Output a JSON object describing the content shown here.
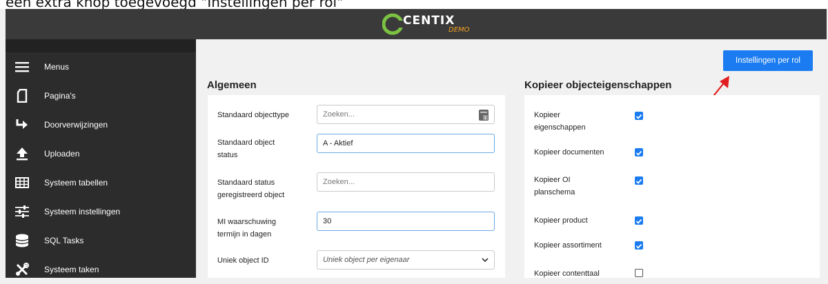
{
  "caption": "een extra knop toegevoegd \"Instellingen per rol\"",
  "app": {
    "logo_text": "CENTIX",
    "logo_sub": "DEMO"
  },
  "sidebar": {
    "items": [
      {
        "label": "Menus",
        "icon": "hamburger-icon"
      },
      {
        "label": "Pagina's",
        "icon": "page-icon"
      },
      {
        "label": "Doorverwijzingen",
        "icon": "redirect-arrow-icon"
      },
      {
        "label": "Uploaden",
        "icon": "upload-icon"
      },
      {
        "label": "Systeem tabellen",
        "icon": "table-icon"
      },
      {
        "label": "Systeem instellingen",
        "icon": "sliders-icon"
      },
      {
        "label": "SQL Tasks",
        "icon": "database-icon"
      },
      {
        "label": "Systeem taken",
        "icon": "tools-icon"
      }
    ]
  },
  "toolbar": {
    "roles_button": "Instellingen per rol"
  },
  "algemeen": {
    "title": "Algemeen",
    "fields": [
      {
        "label": "Standaard objecttype",
        "value": "",
        "placeholder": "Zoeken..."
      },
      {
        "label": "Standaard object status",
        "value": "A - Aktief",
        "placeholder": ""
      },
      {
        "label": "Standaard status geregistreerd object",
        "value": "",
        "placeholder": "Zoeken..."
      },
      {
        "label": "MI waarschuwing termijn in dagen",
        "value": "30",
        "placeholder": ""
      },
      {
        "label": "Uniek object ID",
        "value": "Uniek object per eigenaar",
        "placeholder": ""
      }
    ]
  },
  "kopieer": {
    "title": "Kopieer objecteigenschappen",
    "items": [
      {
        "label": "Kopieer eigenschappen",
        "checked": true
      },
      {
        "label": "Kopieer documenten",
        "checked": true
      },
      {
        "label": "Kopieer OI planschema",
        "checked": true
      },
      {
        "label": "Kopieer product",
        "checked": true
      },
      {
        "label": "Kopieer assortiment",
        "checked": true
      },
      {
        "label": "Kopieer contenttaal",
        "checked": false
      }
    ]
  },
  "colors": {
    "accent": "#1a7cf0",
    "sidebar_bg": "#2c2c2c",
    "topbar_bg": "#3a3a3a",
    "annotation": "#e02020"
  }
}
